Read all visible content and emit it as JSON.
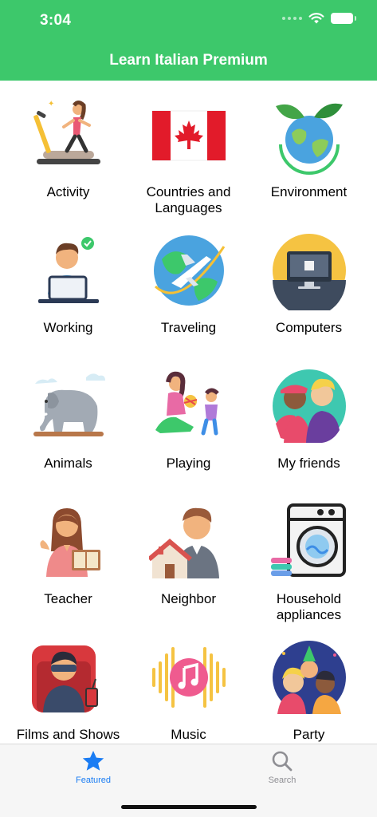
{
  "status_bar": {
    "time": "3:04"
  },
  "nav": {
    "title": "Learn Italian Premium"
  },
  "categories": [
    {
      "label": "Activity",
      "icon": "treadmill-runner-icon"
    },
    {
      "label": "Countries and Languages",
      "icon": "canada-flag-icon"
    },
    {
      "label": "Environment",
      "icon": "earth-leaves-icon"
    },
    {
      "label": "Working",
      "icon": "laptop-worker-icon"
    },
    {
      "label": "Traveling",
      "icon": "airplane-globe-icon"
    },
    {
      "label": "Computers",
      "icon": "monitor-icon"
    },
    {
      "label": "Animals",
      "icon": "elephant-icon"
    },
    {
      "label": "Playing",
      "icon": "mother-child-ball-icon"
    },
    {
      "label": "My friends",
      "icon": "friends-icon"
    },
    {
      "label": "Teacher",
      "icon": "teacher-book-icon"
    },
    {
      "label": "Neighbor",
      "icon": "neighbor-house-icon"
    },
    {
      "label": "Household appliances",
      "icon": "washing-machine-icon"
    },
    {
      "label": "Films and Shows",
      "icon": "cinema-viewer-icon"
    },
    {
      "label": "Music",
      "icon": "music-note-icon"
    },
    {
      "label": "Party",
      "icon": "party-people-icon"
    }
  ],
  "tabbar": {
    "featured_label": "Featured",
    "search_label": "Search",
    "active_color": "#1a7cf3",
    "inactive_color": "#8e8e93"
  },
  "colors": {
    "header": "#3dc86b"
  }
}
